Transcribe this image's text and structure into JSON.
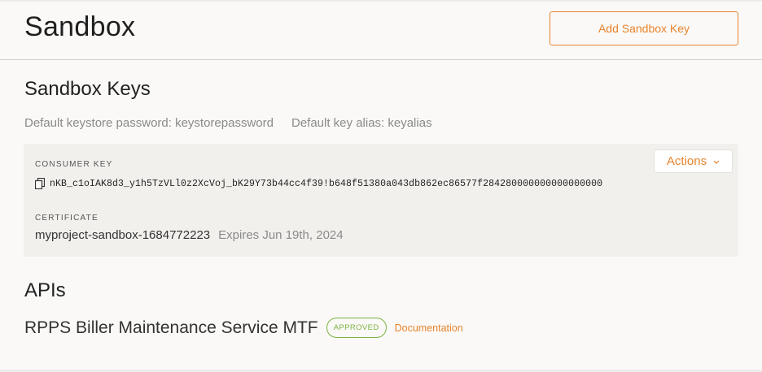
{
  "header": {
    "title": "Sandbox",
    "add_button_label": "Add Sandbox Key"
  },
  "sandbox_keys": {
    "title": "Sandbox Keys",
    "default_password": "Default keystore password: keystorepassword",
    "default_alias": "Default key alias: keyalias",
    "card": {
      "consumer_key_label": "CONSUMER KEY",
      "consumer_key_value": "nKB_c1oIAK8d3_y1h5TzVLl0z2XcVoj_bK29Y73b44cc4f39!b648f51380a043db862ec86577f284280000000000000000",
      "certificate_label": "CERTIFICATE",
      "certificate_name": "myproject-sandbox-1684772223",
      "certificate_expiry": "Expires Jun 19th, 2024",
      "actions_label": "Actions"
    }
  },
  "apis": {
    "title": "APIs",
    "items": [
      {
        "name": "RPPS Biller Maintenance Service MTF",
        "status": "APPROVED",
        "link_label": "Documentation"
      }
    ]
  },
  "colors": {
    "accent": "#e8842c",
    "approved": "#7cb342",
    "background": "#faf9f7",
    "card": "#f1f0ed"
  },
  "icons": [
    "copy-icon",
    "chevron-down-icon"
  ]
}
